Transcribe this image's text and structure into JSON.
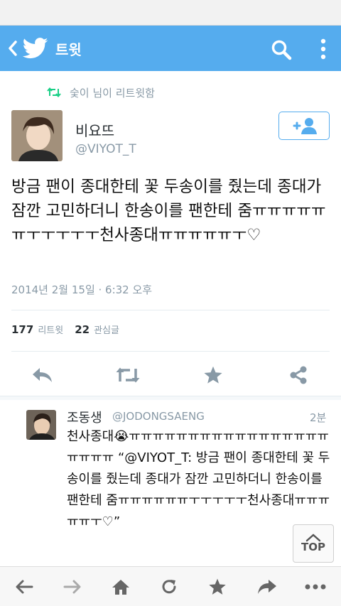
{
  "header": {
    "title": "트윗",
    "back_icon": "chevron-left-icon",
    "logo_icon": "twitter-bird-icon",
    "search_icon": "search-icon",
    "more_icon": "overflow-menu-icon",
    "color": "#55acee"
  },
  "retweet_notice": "숯이 님이 리트윗함",
  "tweet": {
    "name": "비요뜨",
    "handle": "@VIYOT_T",
    "text": "방금 팬이 종대한테 꽃 두송이를 줬는데 종대가 잠깐 고민하더니 한송이를 팬한테 줌ㅠㅠㅠㅠㅠㅠㅜㅜㅜㅜㅜ천사종대ㅠㅠㅠㅠㅠㅜ♡",
    "timestamp": "2014년 2월 15일 · 6:32 오후",
    "stats": {
      "retweets": "177",
      "retweets_label": "리트윗",
      "favorites": "22",
      "favorites_label": "관심글"
    }
  },
  "actions": [
    "reply-icon",
    "retweet-icon",
    "favorite-star-icon",
    "share-icon"
  ],
  "reply": {
    "name": "조동생",
    "handle": "@JODONGSAENG",
    "time": "2분",
    "text": "천사종대😭ㅠㅠㅠㅠㅠㅠㅠㅠㅠㅠㅠㅠㅠㅠㅠㅠㅠㅠㅠㅠㅠ “@VIYOT_T: 방금 팬이 종대한테 꽃 두송이를 줬는데 종대가 잠깐 고민하더니 한송이를 팬한테 줌ㅠㅠㅠㅠㅠㅠㅜㅜㅜㅜㅜ천사종대ㅠㅠㅠㅠㅠㅜ♡”"
  },
  "top_button": {
    "label": "TOP"
  },
  "browser_nav": [
    "back-arrow-icon",
    "forward-arrow-icon",
    "home-icon",
    "refresh-icon",
    "bookmark-star-icon",
    "share-arrow-icon",
    "more-dots-icon"
  ]
}
